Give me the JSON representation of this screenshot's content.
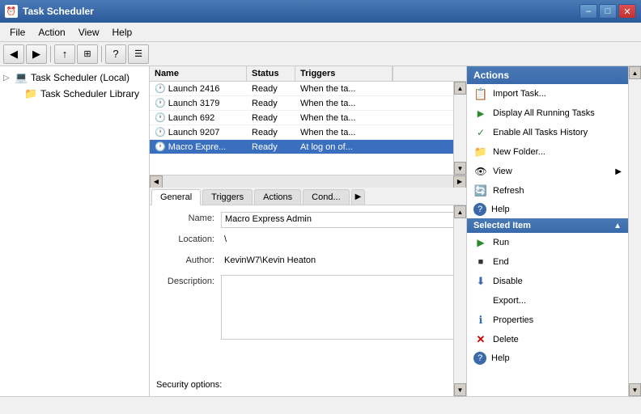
{
  "window": {
    "title": "Task Scheduler",
    "min_label": "–",
    "max_label": "□",
    "close_label": "✕"
  },
  "menu": {
    "items": [
      "File",
      "Action",
      "View",
      "Help"
    ]
  },
  "toolbar": {
    "buttons": [
      "◀",
      "▶",
      "↑",
      "⊞",
      "?",
      "☰"
    ]
  },
  "tree": {
    "items": [
      {
        "label": "Task Scheduler (Local)",
        "level": 0,
        "has_arrow": true,
        "expanded": false
      },
      {
        "label": "Task Scheduler Library",
        "level": 1,
        "has_arrow": false,
        "expanded": false,
        "selected": true
      }
    ]
  },
  "task_list": {
    "columns": [
      "Name",
      "Status",
      "Triggers"
    ],
    "rows": [
      {
        "icon": "🕐",
        "name": "Launch 2416",
        "status": "Ready",
        "triggers": "When the ta..."
      },
      {
        "icon": "🕐",
        "name": "Launch 3179",
        "status": "Ready",
        "triggers": "When the ta..."
      },
      {
        "icon": "🕐",
        "name": "Launch 692",
        "status": "Ready",
        "triggers": "When the ta..."
      },
      {
        "icon": "🕐",
        "name": "Launch 9207",
        "status": "Ready",
        "triggers": "When the ta..."
      },
      {
        "icon": "🕐",
        "name": "Macro Expre...",
        "status": "Ready",
        "triggers": "At log on of..."
      }
    ],
    "selected_index": 4
  },
  "detail_tabs": {
    "tabs": [
      "General",
      "Triggers",
      "Actions",
      "Cond...",
      "▶"
    ],
    "active": "General"
  },
  "detail_form": {
    "name_label": "Name:",
    "name_value": "Macro Express Admin",
    "location_label": "Location:",
    "location_value": "\\",
    "author_label": "Author:",
    "author_value": "KevinW7\\Kevin Heaton",
    "description_label": "Description:",
    "description_value": "",
    "security_label": "Security options:"
  },
  "actions_panel": {
    "header": "Actions",
    "items": [
      {
        "icon": "📥",
        "label": "Import Task...",
        "has_icon": true
      },
      {
        "icon": "▶",
        "label": "Display All Running Tasks",
        "has_icon": true
      },
      {
        "icon": "✓",
        "label": "Enable All Tasks History",
        "has_icon": true
      },
      {
        "icon": "📁",
        "label": "New Folder...",
        "has_icon": true
      },
      {
        "icon": "👁",
        "label": "View",
        "has_icon": true,
        "has_arrow": true
      },
      {
        "icon": "🔄",
        "label": "Refresh",
        "has_icon": true
      },
      {
        "icon": "?",
        "label": "Help",
        "has_icon": true
      }
    ],
    "selected_section": "Selected Item",
    "selected_items": [
      {
        "icon": "▶",
        "label": "Run",
        "color": "green"
      },
      {
        "icon": "■",
        "label": "End",
        "color": "black"
      },
      {
        "icon": "⬇",
        "label": "Disable",
        "color": "blue"
      },
      {
        "icon": "",
        "label": "Export...",
        "color": ""
      },
      {
        "icon": "ℹ",
        "label": "Properties",
        "color": "blue"
      },
      {
        "icon": "✕",
        "label": "Delete",
        "color": "red"
      },
      {
        "icon": "?",
        "label": "Help",
        "color": ""
      }
    ]
  },
  "status_bar": {
    "text": ""
  }
}
